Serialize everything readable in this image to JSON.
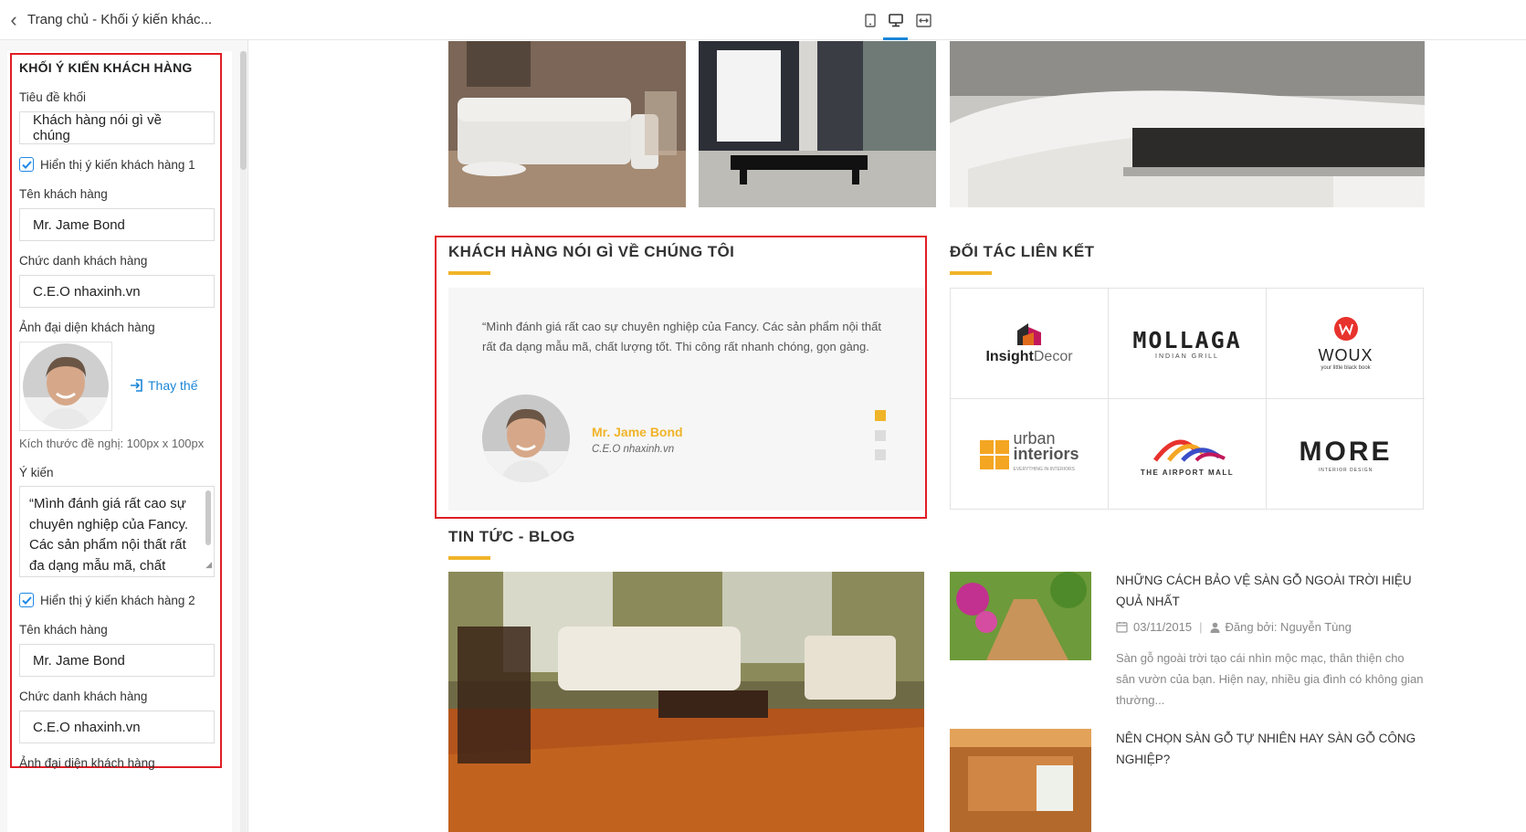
{
  "sidebar": {
    "breadcrumb": "Trang chủ - Khối ý kiến khác...",
    "section_title": "KHỐI Ý KIẾN KHÁCH HÀNG",
    "block_title_label": "Tiêu đề khối",
    "block_title_value": "Khách hàng nói gì về chúng",
    "testimonial1": {
      "show_label": "Hiển thị ý kiến khách hàng 1",
      "checked": true,
      "name_label": "Tên khách hàng",
      "name_value": "Mr. Jame Bond",
      "position_label": "Chức danh khách hàng",
      "position_value": "C.E.O nhaxinh.vn",
      "avatar_label": "Ảnh đại diện khách hàng",
      "replace_label": "Thay thế",
      "size_hint": "Kích thước đề nghị: 100px x 100px",
      "opinion_label": "Ý kiến",
      "opinion_value": "“Mình đánh giá rất cao sự chuyên nghiệp của Fancy. Các sản phẩm nội thất rất đa dạng mẫu mã, chất"
    },
    "testimonial2": {
      "show_label": "Hiển thị ý kiến khách hàng 2",
      "checked": true,
      "name_label": "Tên khách hàng",
      "name_value": "Mr. Jame Bond",
      "position_label": "Chức danh khách hàng",
      "position_value": "C.E.O nhaxinh.vn",
      "avatar_label": "Ảnh đại diện khách hàng"
    }
  },
  "device_bar": {
    "devices": [
      "mobile-icon",
      "desktop-icon",
      "fullwidth-icon"
    ],
    "active": "desktop-icon",
    "accent": "#1a86d8"
  },
  "preview": {
    "testimonial_section": {
      "title": "KHÁCH HÀNG NÓI GÌ VỀ CHÚNG TÔI",
      "quote": "“Mình đánh giá rất cao sự chuyên nghiệp của Fancy. Các sản phẩm nội thất rất đa dạng mẫu mã, chất lượng tốt. Thi công rất nhanh chóng, gọn gàng.",
      "name": "Mr. Jame Bond",
      "position": "C.E.O nhaxinh.vn",
      "slides": 3,
      "active_slide": 1
    },
    "partners_section": {
      "title": "ĐỐI TÁC LIÊN KẾT",
      "partners": [
        {
          "name": "InsightDecor",
          "part1": "Insight",
          "part2": "Decor"
        },
        {
          "name": "MOLLAGA",
          "word": "MOLLAGA",
          "sub": "INDIAN GRILL"
        },
        {
          "name": "WOUX",
          "word": "WOUX",
          "sub": "your little black book"
        },
        {
          "name": "urban interiors",
          "line1": "urban",
          "line2": "interiors",
          "sub": "EVERYTHING IN INTERIORS"
        },
        {
          "name": "THE AIRPORT MALL",
          "word": "THE AIRPORT MALL"
        },
        {
          "name": "MORE",
          "word": "MORE",
          "sub": "INTERIOR DESIGN"
        }
      ]
    },
    "news_section": {
      "title": "TIN TỨC - BLOG",
      "items": [
        {
          "title": "NHỮNG CÁCH BẢO VỆ SÀN GỖ NGOÀI TRỜI HIỆU QUẢ NHẤT",
          "date": "03/11/2015",
          "author": "Đăng bởi: Nguyễn Tùng",
          "excerpt": "Sàn gỗ ngoài trời tạo cái nhìn mộc mạc, thân thiện cho sân vườn của bạn. Hiện nay, nhiều gia đình có không gian thường..."
        },
        {
          "title": "NÊN CHỌN SÀN GỖ TỰ NHIÊN HAY SÀN GỖ CÔNG NGHIỆP?"
        }
      ]
    },
    "colors": {
      "accent_yellow": "#f0b429",
      "highlight_red": "#e01e25"
    }
  }
}
